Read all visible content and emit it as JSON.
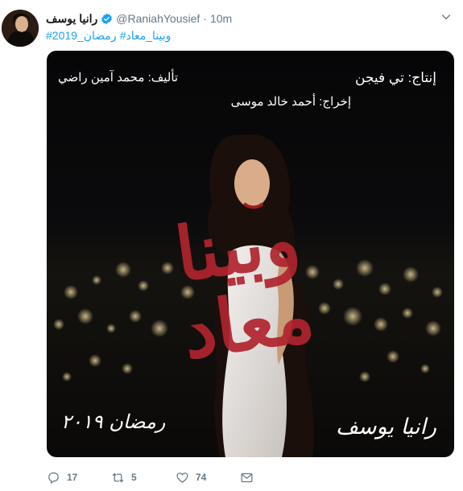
{
  "tweet": {
    "name": "رانيا يوسف",
    "handle": "@RaniahYousief",
    "dot": "·",
    "time": "10m",
    "hashtags": [
      "#رمضان_2019",
      "#وبينا_معاد"
    ]
  },
  "poster": {
    "producer": "إنتاج: تي فيجن",
    "writer": "تأليف: محمد آمين راضي",
    "director": "إخراج: أحمد خالد موسى",
    "title": "وبينا\nمعاد",
    "actor": "رانيا يوسف",
    "season": "رمضان ٢٠١٩"
  },
  "actions": {
    "reply_count": "17",
    "retweet_count": "5",
    "like_count": "74"
  },
  "colors": {
    "link": "#1da1f2",
    "muted": "#657786",
    "title_red": "#b0242e"
  },
  "icons": [
    "avatar",
    "verified-icon",
    "chevron-down-icon",
    "reply-icon",
    "retweet-icon",
    "heart-icon",
    "mail-icon"
  ]
}
